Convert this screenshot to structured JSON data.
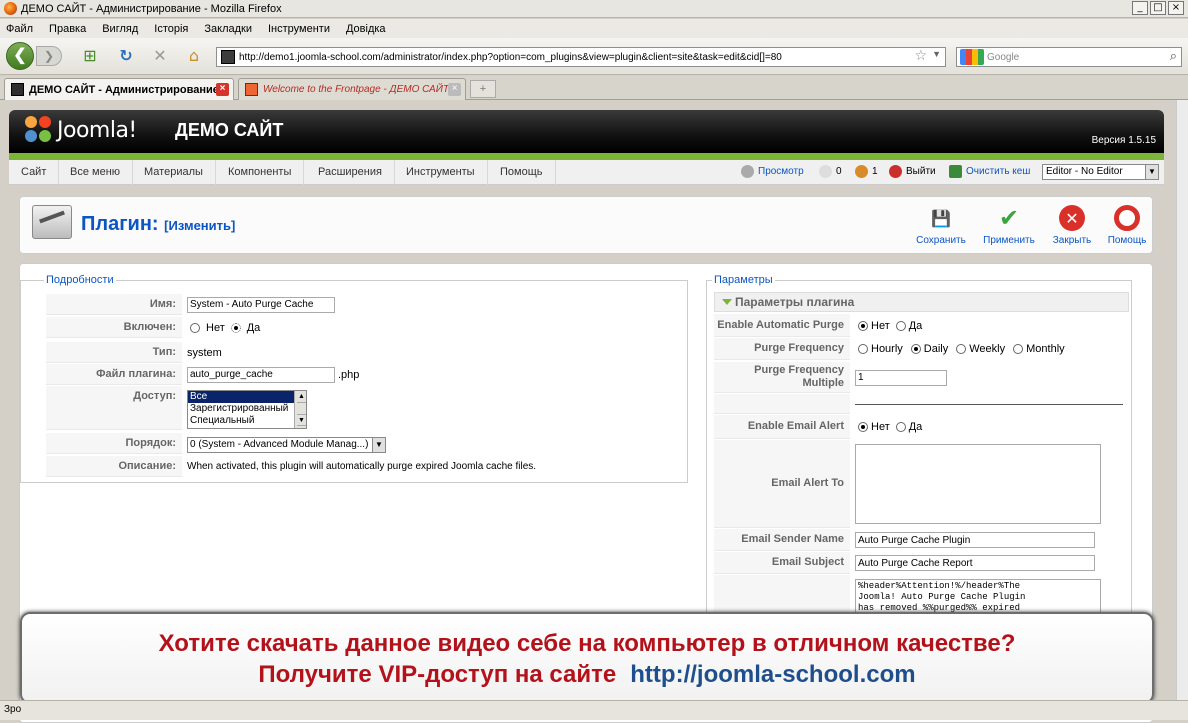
{
  "window": {
    "title": "ДЕМО САЙТ - Администрирование - Mozilla Firefox",
    "controls": [
      "_",
      "□",
      "×"
    ]
  },
  "menubar": [
    "Файл",
    "Правка",
    "Вигляд",
    "Історія",
    "Закладки",
    "Інструменти",
    "Довідка"
  ],
  "nav": {
    "url": "http://demo1.joomla-school.com/administrator/index.php?option=com_plugins&view=plugin&client=site&task=edit&cid[]=80",
    "search_placeholder": "Google"
  },
  "tabs": [
    {
      "label": "ДЕМО САЙТ - Администрирование",
      "active": true
    },
    {
      "label": "Welcome to the Frontpage - ДЕМО САЙТ",
      "active": false
    }
  ],
  "joomla": {
    "logo_text": "Joomla!",
    "site_name": "ДЕМО САЙТ",
    "version": "Версия 1.5.15",
    "menu": [
      "Сайт",
      "Все меню",
      "Материалы",
      "Компоненты",
      "Расширения",
      "Инструменты",
      "Помощь"
    ],
    "status": {
      "preview": "Просмотр",
      "messages": "0",
      "users": "1",
      "logout": "Выйти",
      "clear_cache": "Очистить кеш",
      "editor": "Editor - No Editor"
    }
  },
  "page": {
    "title": "Плагин:",
    "subtitle": "[Изменить]",
    "buttons": {
      "save": "Сохранить",
      "apply": "Применить",
      "close": "Закрыть",
      "help": "Помощь"
    }
  },
  "details": {
    "legend": "Подробности",
    "name_label": "Имя:",
    "name_value": "System - Auto Purge Cache",
    "enabled_label": "Включен:",
    "no": "Нет",
    "yes": "Да",
    "enabled": "yes",
    "type_label": "Тип:",
    "type_value": "system",
    "file_label": "Файл плагина:",
    "file_value": "auto_purge_cache",
    "file_ext": ".php",
    "access_label": "Доступ:",
    "access_options": [
      "Все",
      "Зарегистрированный",
      "Специальный"
    ],
    "order_label": "Порядок:",
    "order_value": "0 (System - Advanced Module Manag...)",
    "desc_label": "Описание:",
    "desc_value": "When activated, this plugin will automatically purge expired Joomla cache files."
  },
  "params": {
    "legend": "Параметры",
    "section": "Параметры плагина",
    "enable_purge_label": "Enable Automatic Purge",
    "no": "Нет",
    "yes": "Да",
    "enable_purge": "no",
    "freq_label": "Purge Frequency",
    "freq_options": [
      "Hourly",
      "Daily",
      "Weekly",
      "Monthly"
    ],
    "freq_selected": "Daily",
    "multiple_label": "Purge Frequency Multiple",
    "multiple_value": "1",
    "email_alert_label": "Enable Email Alert",
    "email_alert": "no",
    "email_to_label": "Email Alert To",
    "sender_label": "Email Sender Name",
    "sender_value": "Auto Purge Cache Plugin",
    "subject_label": "Email Subject",
    "subject_value": "Auto Purge Cache Report",
    "body_lines": [
      "%header%Attention!%/header%The",
      "Joomla! Auto Purge Cache Plugin",
      "has removed %%purged%% expired"
    ]
  },
  "overlay": {
    "line1": "Хотите скачать данное видео себе на компьютер в отличном качестве?",
    "line2": "Получите VIP-доступ на сайте",
    "url": "http://joomla-school.com"
  },
  "statusbar": "Зро"
}
